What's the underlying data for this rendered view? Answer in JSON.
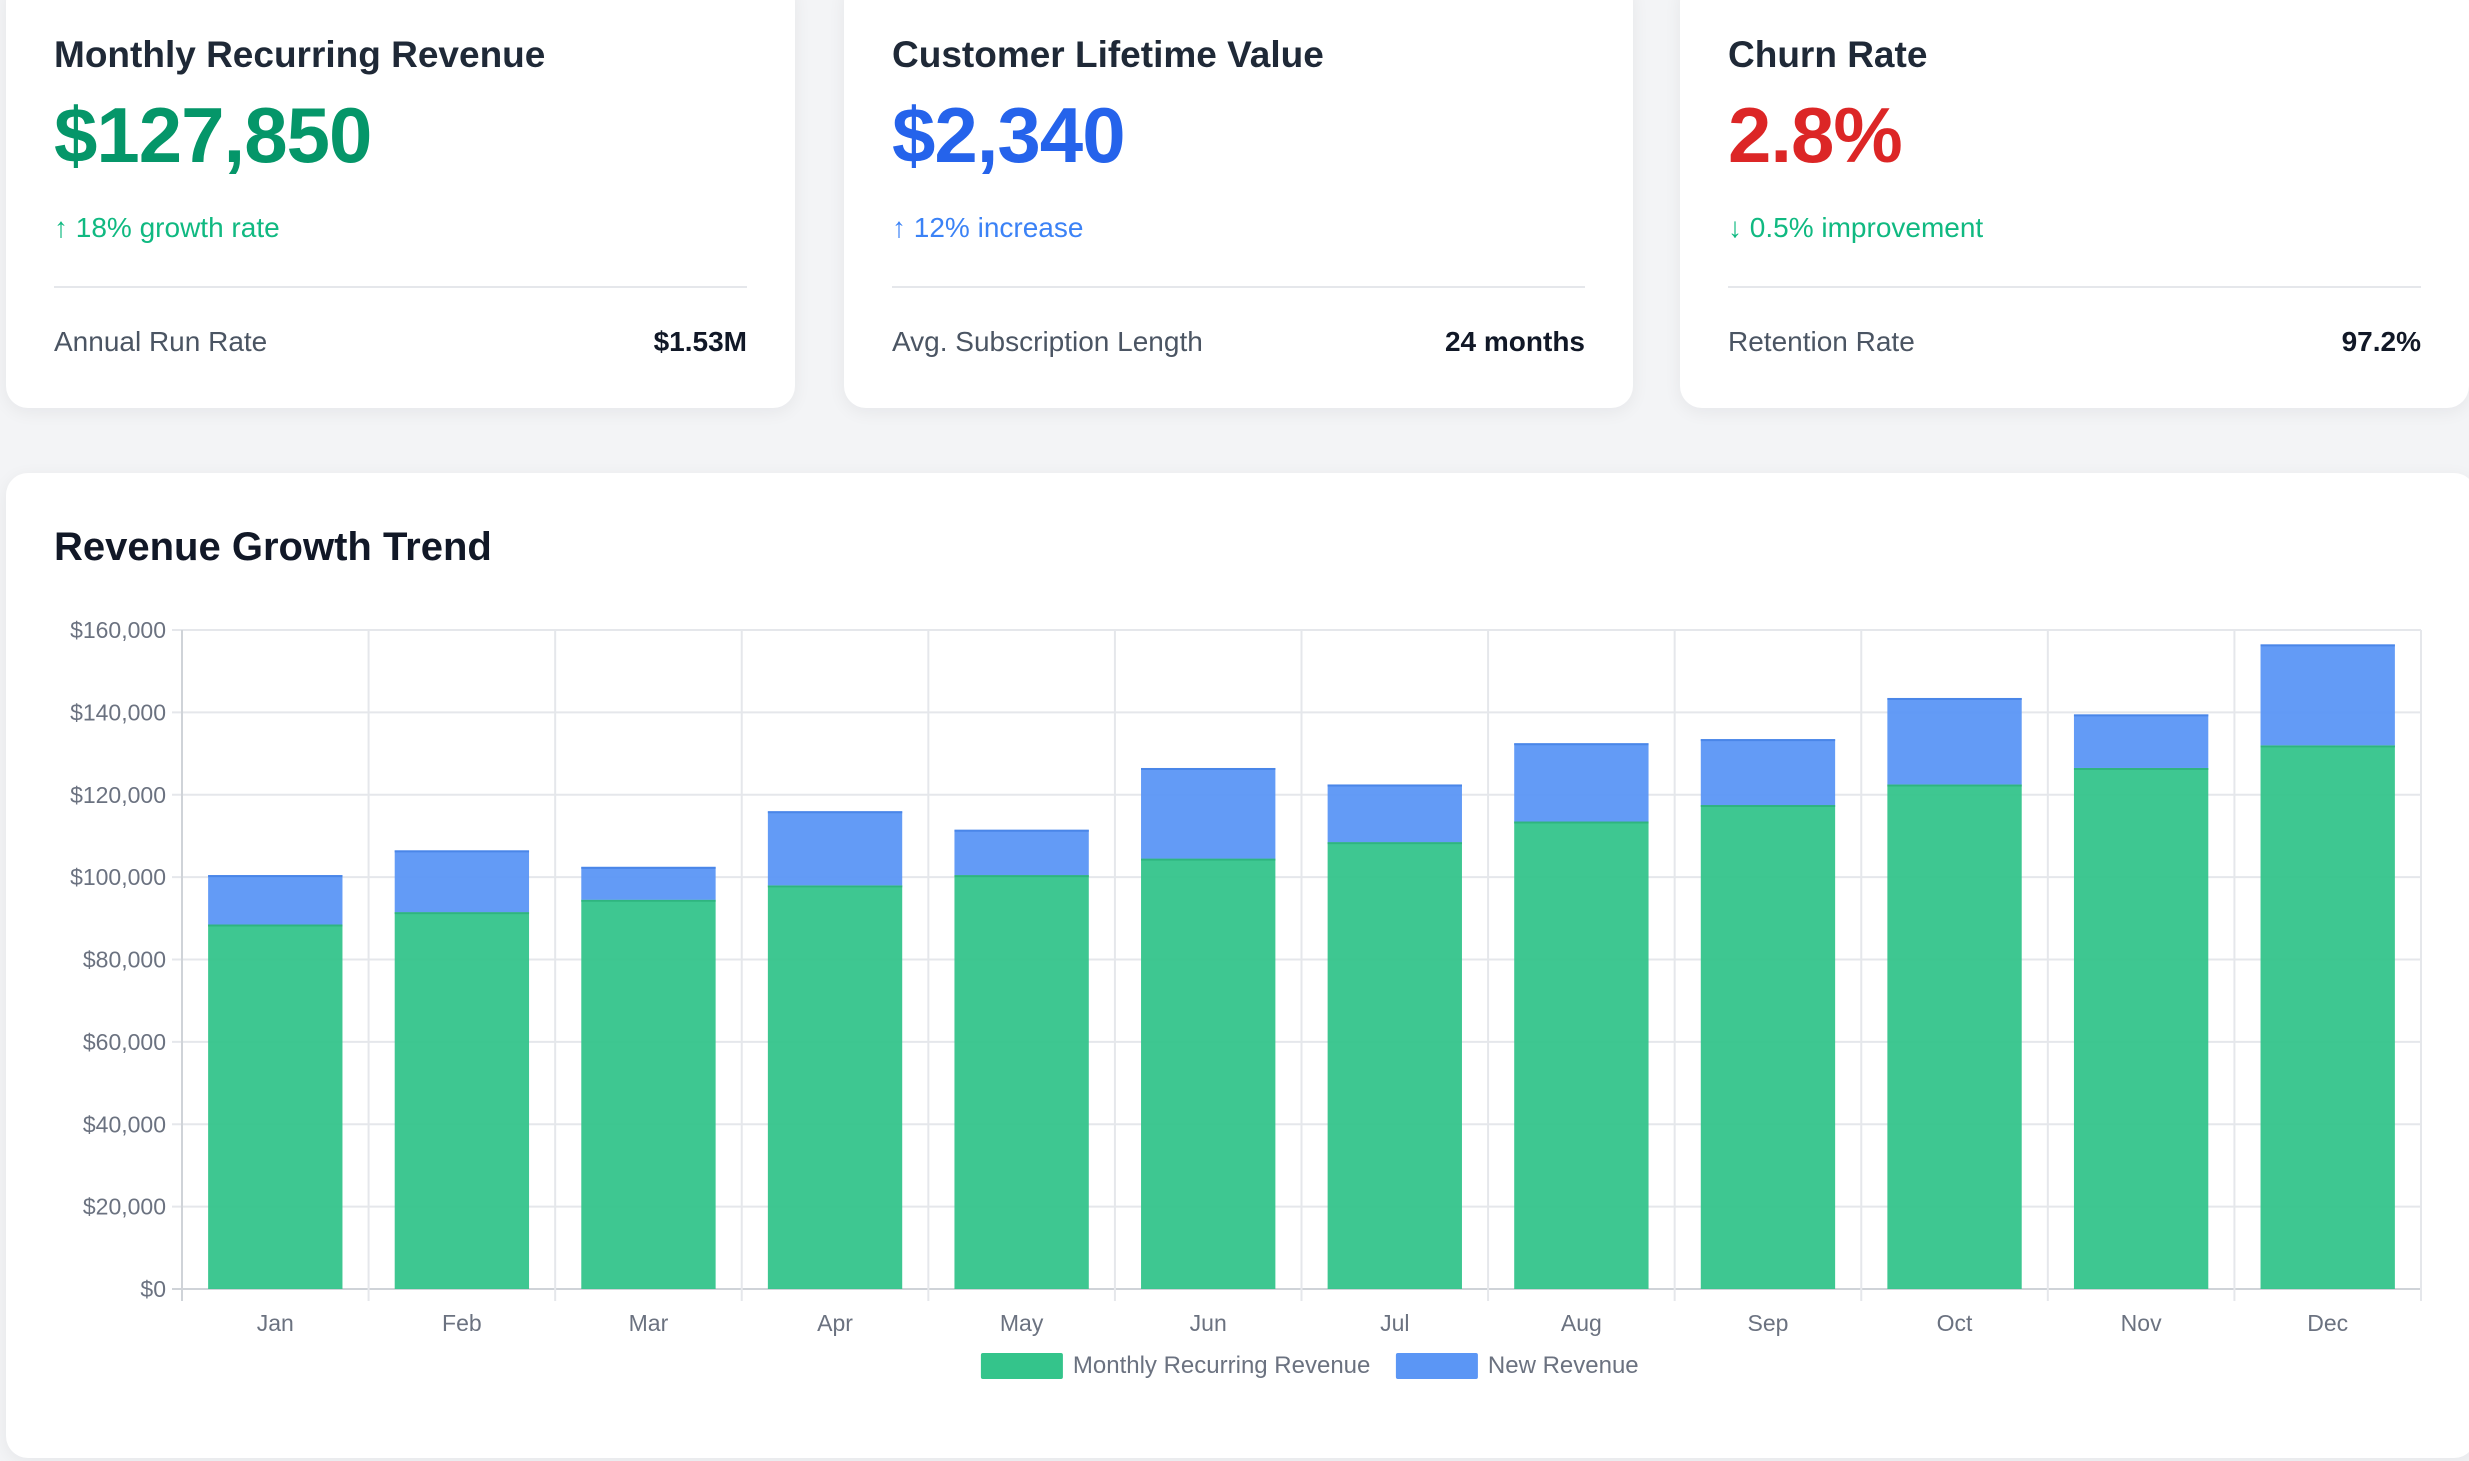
{
  "kpis": [
    {
      "title": "Monthly Recurring Revenue",
      "value": "$127,850",
      "value_color": "#059669",
      "change_arrow": "↑",
      "change": "18% growth rate",
      "change_color": "#10b981",
      "footer_label": "Annual Run Rate",
      "footer_value": "$1.53M"
    },
    {
      "title": "Customer Lifetime Value",
      "value": "$2,340",
      "value_color": "#2563eb",
      "change_arrow": "↑",
      "change": "12% increase",
      "change_color": "#3b82f6",
      "footer_label": "Avg. Subscription Length",
      "footer_value": "24 months"
    },
    {
      "title": "Churn Rate",
      "value": "2.8%",
      "value_color": "#dc2626",
      "change_arrow": "↓",
      "change": "0.5% improvement",
      "change_color": "#10b981",
      "footer_label": "Retention Rate",
      "footer_value": "97.2%"
    }
  ],
  "chart_data": {
    "type": "bar",
    "stacked": true,
    "title": "Revenue Growth Trend",
    "xlabel": "",
    "ylabel": "",
    "categories": [
      "Jan",
      "Feb",
      "Mar",
      "Apr",
      "May",
      "Jun",
      "Jul",
      "Aug",
      "Sep",
      "Oct",
      "Nov",
      "Dec"
    ],
    "series": [
      {
        "name": "Monthly Recurring Revenue",
        "color": "#34c48b",
        "values": [
          88500,
          91500,
          94500,
          98000,
          100500,
          104500,
          108500,
          113500,
          117500,
          122500,
          126500,
          132000
        ]
      },
      {
        "name": "New Revenue",
        "color": "#5b96f5",
        "values": [
          12000,
          15000,
          8000,
          18000,
          11000,
          22000,
          14000,
          19000,
          16000,
          21000,
          13000,
          24500
        ]
      }
    ],
    "ylim": [
      0,
      160000
    ],
    "yticks": [
      0,
      20000,
      40000,
      60000,
      80000,
      100000,
      120000,
      140000,
      160000
    ],
    "ytick_labels": [
      "$0",
      "$20,000",
      "$40,000",
      "$60,000",
      "$80,000",
      "$100,000",
      "$120,000",
      "$140,000",
      "$160,000"
    ],
    "grid": true,
    "legend_position": "bottom"
  }
}
